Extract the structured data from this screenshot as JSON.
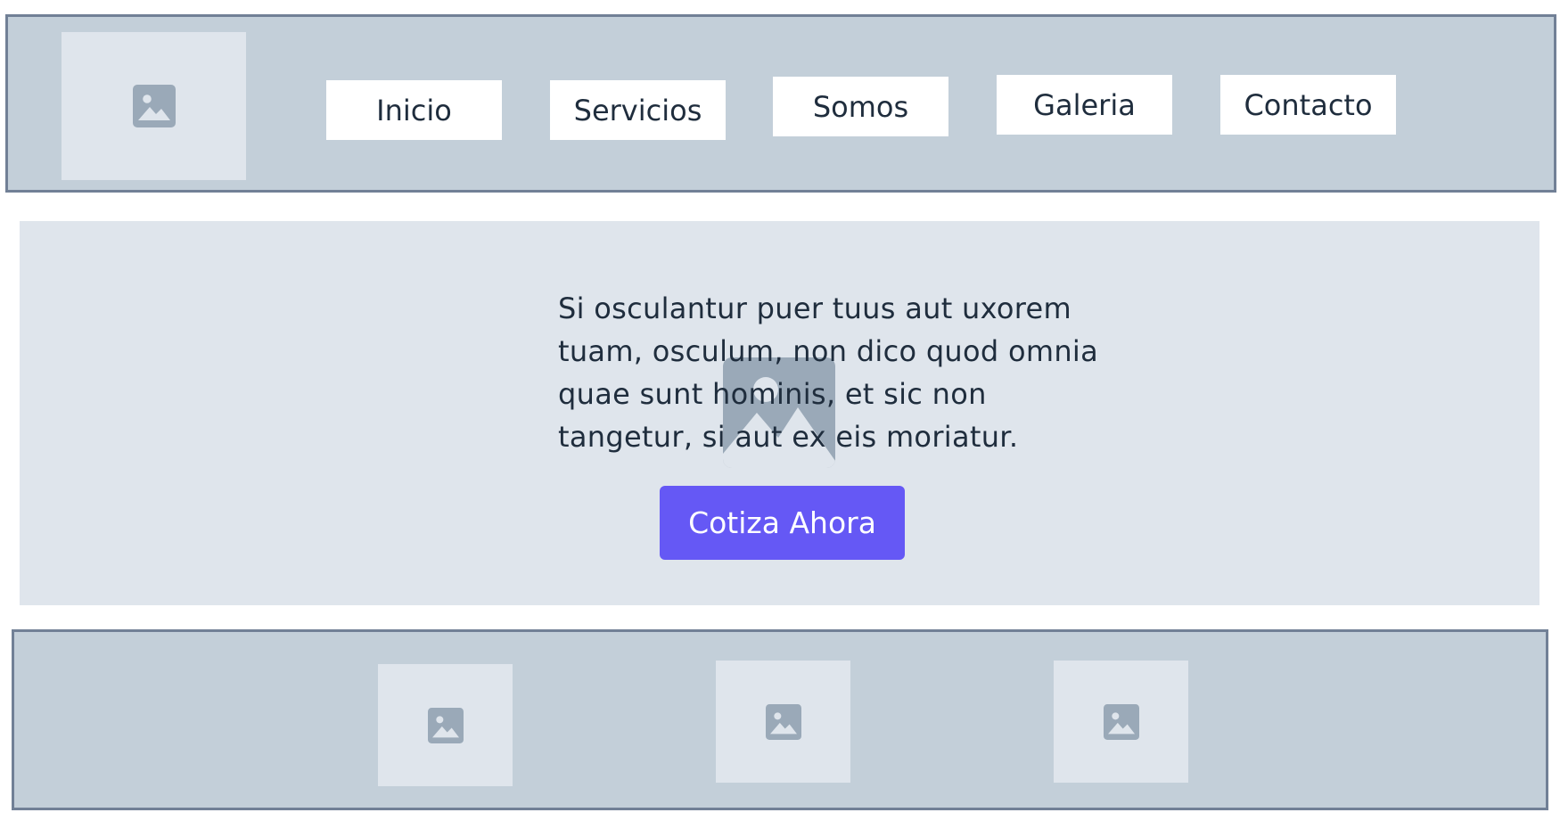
{
  "header": {
    "logo_icon": "image-placeholder-icon",
    "nav": [
      {
        "label": "Inicio"
      },
      {
        "label": "Servicios"
      },
      {
        "label": "Somos"
      },
      {
        "label": "Galeria"
      },
      {
        "label": "Contacto"
      }
    ]
  },
  "hero": {
    "background_icon": "image-placeholder-icon",
    "text": "Si osculantur puer tuus aut uxorem tuam, osculum, non dico quod omnia quae sunt hominis, et sic non tangetur, si aut ex eis moriatur.",
    "cta_label": "Cotiza Ahora"
  },
  "footer": {
    "items": [
      {
        "icon": "image-placeholder-icon"
      },
      {
        "icon": "image-placeholder-icon"
      },
      {
        "icon": "image-placeholder-icon"
      }
    ]
  },
  "colors": {
    "bar_background": "#c3cfd9",
    "bar_border": "#718096",
    "panel_background": "#dfe5ec",
    "placeholder_icon": "#9aa9b8",
    "accent": "#6558f5",
    "text": "#1f2d3d"
  }
}
